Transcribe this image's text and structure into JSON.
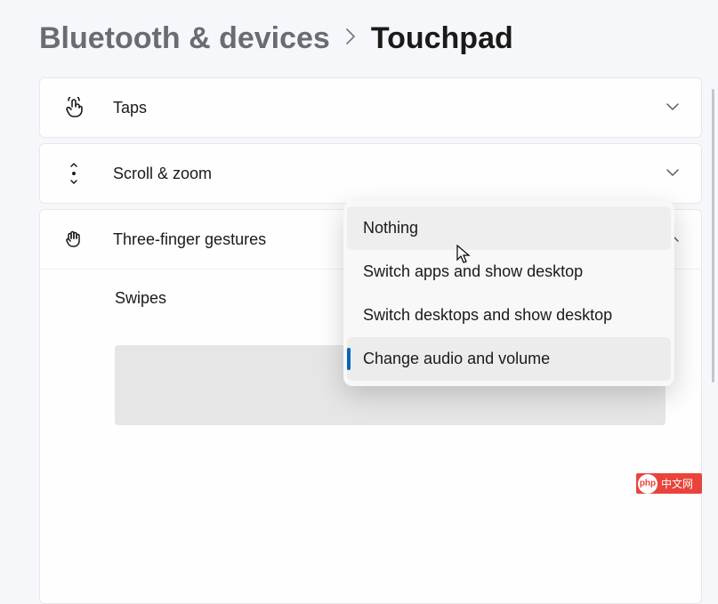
{
  "breadcrumb": {
    "parent": "Bluetooth & devices",
    "current": "Touchpad"
  },
  "cards": {
    "taps": {
      "label": "Taps"
    },
    "scroll_zoom": {
      "label": "Scroll & zoom"
    },
    "three_finger": {
      "label": "Three-finger gestures"
    }
  },
  "swipes": {
    "label": "Swipes"
  },
  "dropdown": {
    "options": [
      {
        "label": "Nothing"
      },
      {
        "label": "Switch apps and show desktop"
      },
      {
        "label": "Switch desktops and show desktop"
      },
      {
        "label": "Change audio and volume"
      }
    ]
  },
  "watermark": {
    "prefix": "php",
    "text": "中文网"
  }
}
